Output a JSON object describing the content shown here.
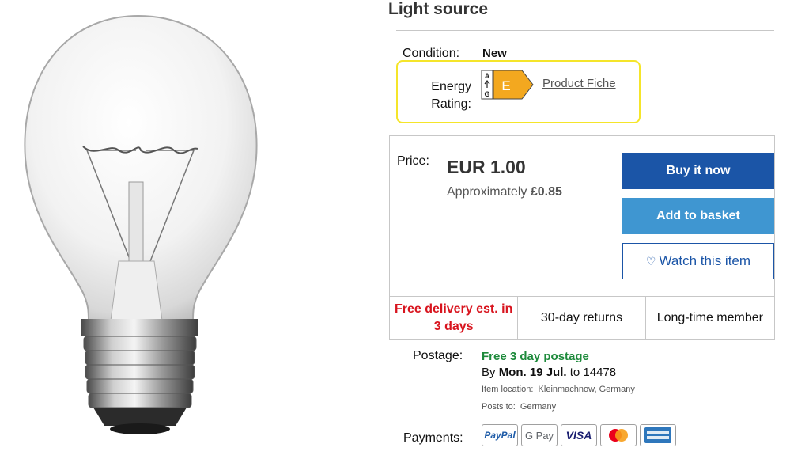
{
  "product": {
    "title": "Light source"
  },
  "details": {
    "condition_label": "Condition:",
    "condition_value": "New",
    "energy_label_line1": "Energy",
    "energy_label_line2": "Rating:",
    "energy_scale_top": "A",
    "energy_scale_bottom": "G",
    "energy_class": "E",
    "product_fiche": "Product Fiche"
  },
  "pricing": {
    "price_label": "Price:",
    "price": "EUR 1.00",
    "approx_prefix": "Approximately ",
    "approx_value": "£0.85"
  },
  "actions": {
    "buy_now": "Buy it now",
    "add_to_basket": "Add to basket",
    "watch": "Watch this item"
  },
  "features": {
    "delivery": "Free delivery est. in 3 days",
    "returns": "30-day returns",
    "member": "Long-time member"
  },
  "postage": {
    "label": "Postage:",
    "free": "Free 3 day postage",
    "by_prefix": "By ",
    "by_date": "Mon. 19 Jul.",
    "by_suffix": " to 14478",
    "item_location_label": "Item location:",
    "item_location": "Kleinmachnow, Germany",
    "posts_to_label": "Posts to:",
    "posts_to": "Germany"
  },
  "payments": {
    "label": "Payments:",
    "methods": [
      "PayPal",
      "G Pay",
      "VISA",
      "mastercard-icon",
      "amex-icon"
    ]
  },
  "colors": {
    "buy_now": "#1b55a7",
    "add_to_basket": "#3f96d1",
    "free_delivery": "#d8141e",
    "free_postage": "#1d8a3b",
    "energy_highlight": "#f5e52a",
    "energy_class_e": "#f3a81f"
  }
}
